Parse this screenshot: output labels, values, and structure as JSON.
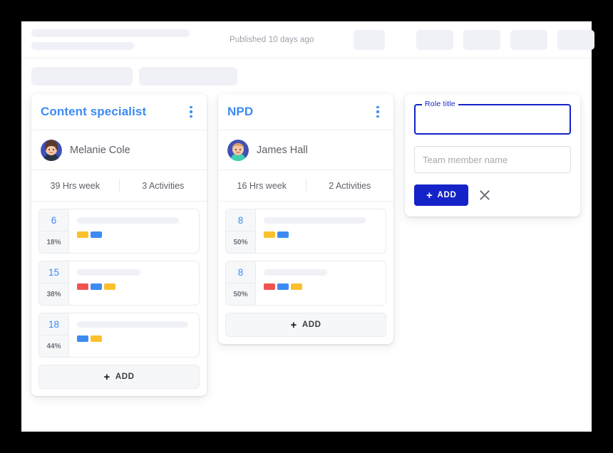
{
  "header": {
    "published_text": "Published 10 days ago",
    "skeleton_bars": 2,
    "chips": 5
  },
  "board": {
    "cards": [
      {
        "role_title": "Content specialist",
        "person_name": "Melanie Cole",
        "avatar_icon": "avatar-female-brown-hair",
        "menu_icon": "kebab-menu-icon",
        "hours": "39 Hrs week",
        "activities_count": "3 Activities",
        "add_label": "ADD",
        "activities": [
          {
            "number": "6",
            "percent": "18%",
            "bar_width": "89%",
            "tags": [
              "#fbc02d",
              "#3d8bf2"
            ]
          },
          {
            "number": "15",
            "percent": "38%",
            "bar_width": "55%",
            "tags": [
              "#ef5350",
              "#3d8bf2",
              "#fbc02d"
            ]
          },
          {
            "number": "18",
            "percent": "44%",
            "bar_width": "97%",
            "tags": [
              "#3d8bf2",
              "#fbc02d"
            ]
          }
        ]
      },
      {
        "role_title": "NPD",
        "person_name": "James Hall",
        "avatar_icon": "avatar-male-blond-hair",
        "menu_icon": "kebab-menu-icon",
        "hours": "16 Hrs week",
        "activities_count": "2 Activities",
        "add_label": "ADD",
        "activities": [
          {
            "number": "8",
            "percent": "50%",
            "bar_width": "89%",
            "tags": [
              "#fbc02d",
              "#3d8bf2"
            ]
          },
          {
            "number": "8",
            "percent": "50%",
            "bar_width": "55%",
            "tags": [
              "#ef5350",
              "#3d8bf2",
              "#fbc02d"
            ]
          }
        ]
      }
    ]
  },
  "new_role_panel": {
    "role_title_label": "Role title",
    "role_title_value": "",
    "team_member_placeholder": "Team member name",
    "team_member_value": "",
    "add_label": "ADD",
    "close_icon": "close-x-icon"
  },
  "colors": {
    "accent_blue": "#3d8bf2",
    "brand_blue": "#1423c8",
    "skeleton": "#f0f1f7",
    "tag_red": "#ef5350",
    "tag_yellow": "#fbc02d",
    "page_bg": "#ffffff",
    "canvas_bg": "#000000"
  }
}
